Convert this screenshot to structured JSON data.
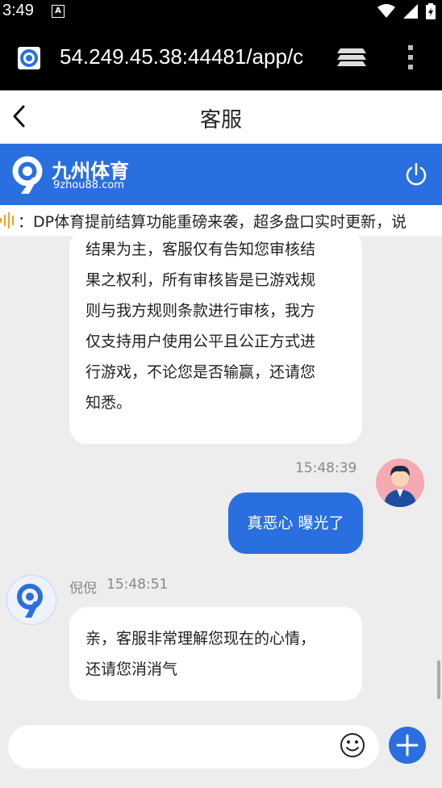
{
  "status_bar": {
    "time": "3:49",
    "notification_letter": "A"
  },
  "browser": {
    "url": "54.249.45.38:44481/app/c"
  },
  "header": {
    "title": "客服"
  },
  "brand": {
    "name": "九州体育",
    "domain": "9zhou88.com"
  },
  "notice": {
    "text": "DP体育提前结算功能重磅来袭，超多盘口实时更新，说"
  },
  "messages": [
    {
      "from": "agent",
      "lines": [
        "结果为主，客服仅有告知您审核结",
        "果之权利，所有审核皆是已游戏规",
        "则与我方规则条款进行审核，我方",
        "仅支持用户使用公平且公正方式进",
        "行游戏，不论您是否输赢，还请您",
        "知悉。"
      ]
    },
    {
      "from": "user",
      "time": "15:48:39",
      "text": "真恶心 曝光了"
    },
    {
      "from": "agent",
      "sender": "倪倪",
      "time": "15:48:51",
      "lines": [
        "亲，客服非常理解您现在的心情，",
        "还请您消消气"
      ]
    }
  ],
  "input": {
    "placeholder": ""
  },
  "colors": {
    "primary": "#2a6fe0",
    "background": "#ededed"
  }
}
